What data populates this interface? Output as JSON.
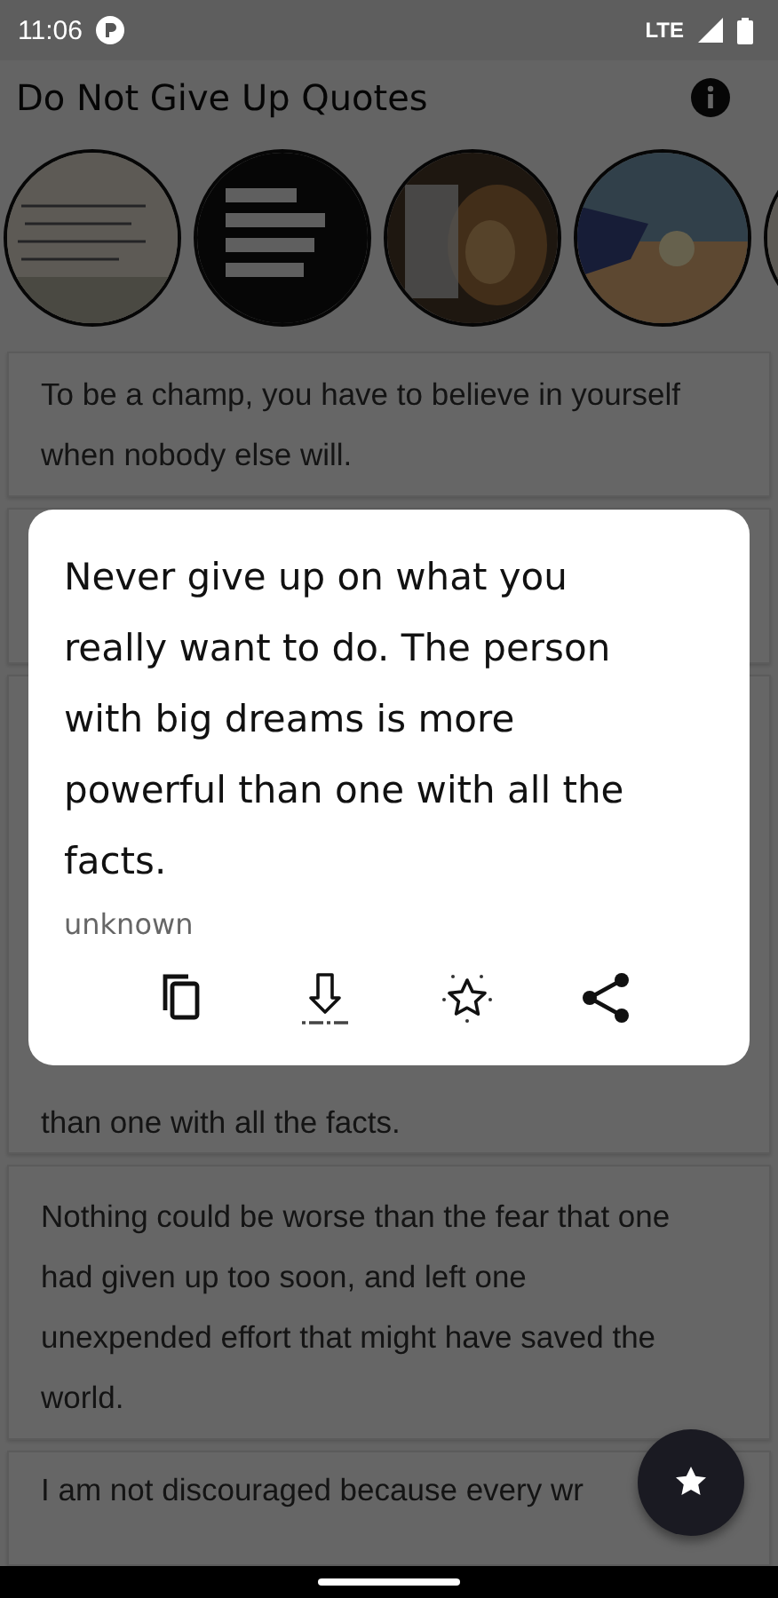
{
  "status_bar": {
    "time": "11:06",
    "network": "LTE"
  },
  "app_bar": {
    "title": "Do Not Give Up Quotes"
  },
  "stories": [
    {
      "kind": "paper"
    },
    {
      "kind": "dark"
    },
    {
      "kind": "animal"
    },
    {
      "kind": "sunset"
    },
    {
      "kind": "paper"
    }
  ],
  "quotes": [
    {
      "kind": "text",
      "lines": [
        "To be a champ, you have to believe in yourself when nobody else will."
      ]
    },
    {
      "kind": "covered"
    },
    {
      "kind": "text",
      "lines": [
        "than one with all the facts."
      ]
    },
    {
      "kind": "text",
      "lines": [
        "Nothing could be worse than the fear that one had given up too soon, and left one unexpended effort that might have saved the world."
      ]
    },
    {
      "kind": "text",
      "lines": [
        "I am not discouraged because every wr"
      ]
    }
  ],
  "dialog": {
    "quote": "Never give up on what you really want to do. The person with big dreams is more powerful than one with all the facts.",
    "author": "unknown",
    "actions": [
      {
        "kind": "copy"
      },
      {
        "kind": "download"
      },
      {
        "kind": "favorite"
      },
      {
        "kind": "share"
      }
    ]
  }
}
